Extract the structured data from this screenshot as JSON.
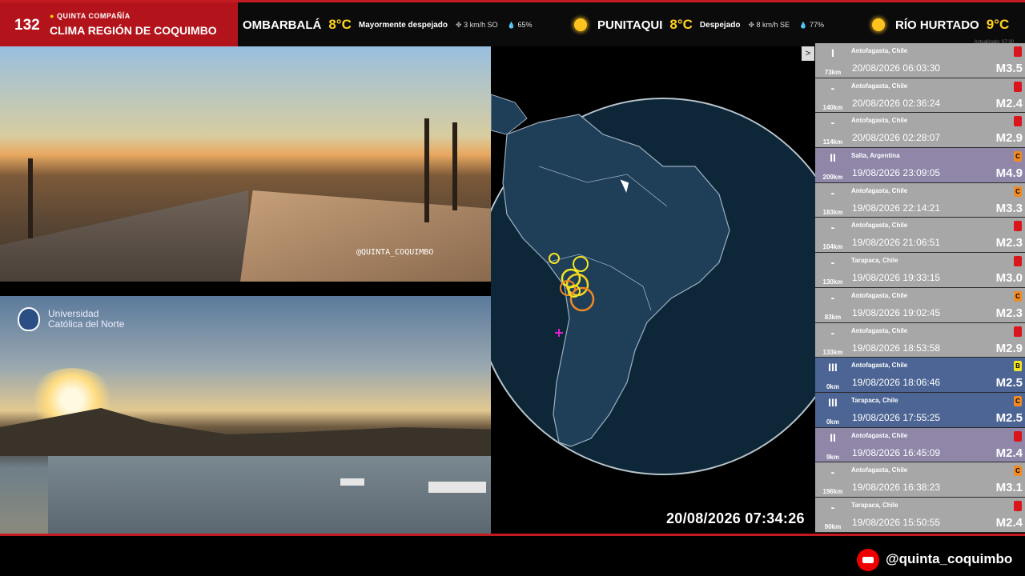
{
  "brand": {
    "number": "132",
    "subtitle": "QUINTA COMPAÑÍA",
    "title": "CLIMA REGIÓN DE COQUIMBO"
  },
  "weather": [
    {
      "name": "OMBARBALÁ",
      "temp": "8°C",
      "desc": "Mayormente despejado",
      "wind": "3 km/h SO",
      "humidity": "65%",
      "icon": "sun-icon"
    },
    {
      "name": "PUNITAQUI",
      "temp": "8°C",
      "desc": "Despejado",
      "wind": "8 km/h SE",
      "humidity": "77%",
      "icon": "sun-icon"
    },
    {
      "name": "RÍO HURTADO",
      "temp": "9°C",
      "desc": "",
      "wind": "",
      "humidity": "",
      "icon": "sun-icon"
    }
  ],
  "updated": "Actualizado: 07:30",
  "cam1": {
    "watermark": "@QUINTA_COQUIMBO"
  },
  "cam2": {
    "logo_line1": "Universidad",
    "logo_line2": "Católica del Norte"
  },
  "clock": "20/08/2026 07:34:26",
  "panel_toggle": ">",
  "earthquakes": [
    {
      "intensity": "I",
      "distance": "73km",
      "place": "Antofagasta, Chile",
      "time": "20/08/2026 06:03:30",
      "magnitude": "M3.5",
      "badge": "",
      "badge_color": "#d8161c",
      "style": "gray"
    },
    {
      "intensity": "-",
      "distance": "140km",
      "place": "Antofagasta, Chile",
      "time": "20/08/2026 02:36:24",
      "magnitude": "M2.4",
      "badge": "",
      "badge_color": "#d8161c",
      "style": "gray"
    },
    {
      "intensity": "-",
      "distance": "114km",
      "place": "Antofagasta, Chile",
      "time": "20/08/2026 02:28:07",
      "magnitude": "M2.9",
      "badge": "",
      "badge_color": "#d8161c",
      "style": "gray"
    },
    {
      "intensity": "II",
      "distance": "209km",
      "place": "Salta, Argentina",
      "time": "19/08/2026 23:09:05",
      "magnitude": "M4.9",
      "badge": "C",
      "badge_color": "#f08a24",
      "style": "purple"
    },
    {
      "intensity": "-",
      "distance": "183km",
      "place": "Antofagasta, Chile",
      "time": "19/08/2026 22:14:21",
      "magnitude": "M3.3",
      "badge": "C",
      "badge_color": "#f08a24",
      "style": "gray"
    },
    {
      "intensity": "-",
      "distance": "104km",
      "place": "Antofagasta, Chile",
      "time": "19/08/2026 21:06:51",
      "magnitude": "M2.3",
      "badge": "",
      "badge_color": "#d8161c",
      "style": "gray"
    },
    {
      "intensity": "-",
      "distance": "130km",
      "place": "Tarapaca, Chile",
      "time": "19/08/2026 19:33:15",
      "magnitude": "M3.0",
      "badge": "",
      "badge_color": "#d8161c",
      "style": "gray"
    },
    {
      "intensity": "-",
      "distance": "83km",
      "place": "Antofagasta, Chile",
      "time": "19/08/2026 19:02:45",
      "magnitude": "M2.3",
      "badge": "C",
      "badge_color": "#f08a24",
      "style": "gray"
    },
    {
      "intensity": "-",
      "distance": "133km",
      "place": "Antofagasta, Chile",
      "time": "19/08/2026 18:53:58",
      "magnitude": "M2.9",
      "badge": "",
      "badge_color": "#d8161c",
      "style": "gray"
    },
    {
      "intensity": "III",
      "distance": "0km",
      "place": "Antofagasta, Chile",
      "time": "19/08/2026 18:06:46",
      "magnitude": "M2.5",
      "badge": "B",
      "badge_color": "#f5e623",
      "style": "blue"
    },
    {
      "intensity": "III",
      "distance": "0km",
      "place": "Tarapaca, Chile",
      "time": "19/08/2026 17:55:25",
      "magnitude": "M2.5",
      "badge": "C",
      "badge_color": "#f08a24",
      "style": "blue"
    },
    {
      "intensity": "II",
      "distance": "9km",
      "place": "Antofagasta, Chile",
      "time": "19/08/2026 16:45:09",
      "magnitude": "M2.4",
      "badge": "",
      "badge_color": "#d8161c",
      "style": "purple"
    },
    {
      "intensity": "-",
      "distance": "196km",
      "place": "Antofagasta, Chile",
      "time": "19/08/2026 16:38:23",
      "magnitude": "M3.1",
      "badge": "C",
      "badge_color": "#f08a24",
      "style": "gray"
    },
    {
      "intensity": "-",
      "distance": "90km",
      "place": "Tarapaca, Chile",
      "time": "19/08/2026 15:50:55",
      "magnitude": "M2.4",
      "badge": "",
      "badge_color": "#d8161c",
      "style": "gray"
    }
  ],
  "footer": {
    "handle": "@quinta_coquimbo",
    "icon": "youtube-icon"
  }
}
